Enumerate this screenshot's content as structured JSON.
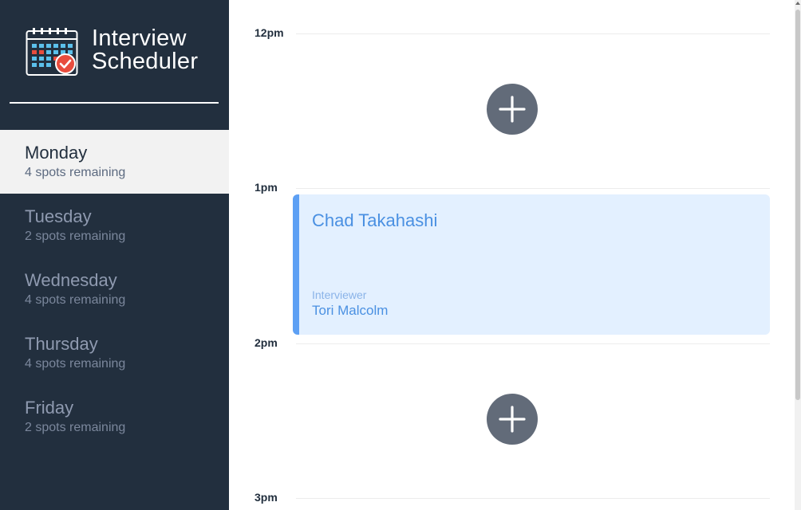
{
  "brand": {
    "line1": "Interview",
    "line2": "Scheduler",
    "logo_icon": "calendar-check-icon",
    "accent_color": "#e84c3d"
  },
  "days": [
    {
      "name": "Monday",
      "spots": "4 spots remaining",
      "selected": true
    },
    {
      "name": "Tuesday",
      "spots": "2 spots remaining",
      "selected": false
    },
    {
      "name": "Wednesday",
      "spots": "4 spots remaining",
      "selected": false
    },
    {
      "name": "Thursday",
      "spots": "4 spots remaining",
      "selected": false
    },
    {
      "name": "Friday",
      "spots": "2 spots remaining",
      "selected": false
    }
  ],
  "schedule": {
    "slots": [
      {
        "time": "12pm",
        "state": "empty"
      },
      {
        "time": "1pm",
        "state": "booked",
        "student": "Chad Takahashi",
        "interviewer_label": "Interviewer",
        "interviewer": "Tori Malcolm"
      },
      {
        "time": "2pm",
        "state": "empty"
      },
      {
        "time": "3pm",
        "state": "partial"
      }
    ],
    "add_icon": "plus-icon"
  },
  "colors": {
    "sidebar_bg": "#222f3e",
    "selected_bg": "#f2f2f2",
    "appointment_bg": "#e3f0ff",
    "appointment_accent": "#5da0f4",
    "add_button": "#626b79"
  }
}
